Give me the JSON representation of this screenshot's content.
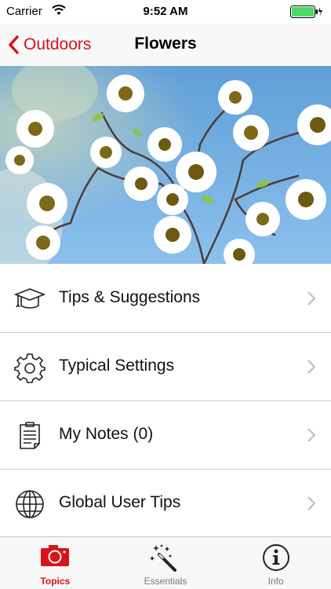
{
  "status_bar": {
    "carrier": "Carrier",
    "time": "9:52 AM"
  },
  "nav": {
    "back_label": "Outdoors",
    "title": "Flowers"
  },
  "hero": {
    "description_icon": "flowers-photo"
  },
  "menu": [
    {
      "label": "Tips & Suggestions",
      "icon": "graduation-cap-icon"
    },
    {
      "label": "Typical Settings",
      "icon": "gear-icon"
    },
    {
      "label": "My Notes (0)",
      "icon": "notes-icon"
    },
    {
      "label": "Global User Tips",
      "icon": "globe-icon"
    }
  ],
  "tabs": [
    {
      "label": "Topics",
      "icon": "camera-icon",
      "active": true
    },
    {
      "label": "Essentials",
      "icon": "magic-wand-icon",
      "active": false
    },
    {
      "label": "Info",
      "icon": "info-icon",
      "active": false
    }
  ],
  "colors": {
    "accent": "#d7141a",
    "battery": "#4cd964"
  }
}
